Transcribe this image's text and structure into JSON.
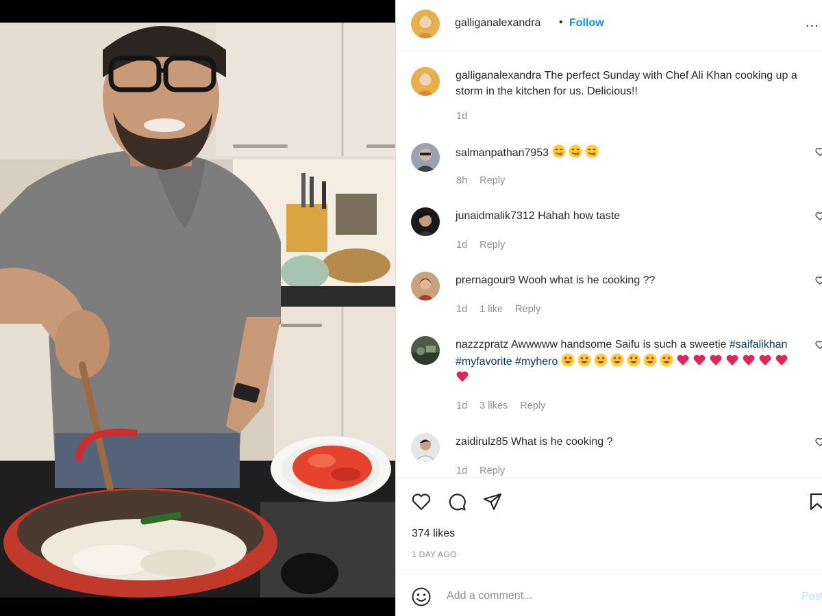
{
  "post": {
    "username": "galliganalexandra",
    "separator": "•",
    "follow_label": "Follow",
    "more_label": "...",
    "caption": "The perfect Sunday with Chef Ali Khan cooking up a storm in the kitchen for us. Delicious!!",
    "caption_time": "1d"
  },
  "comments": [
    {
      "username": "salmanpathan7953",
      "text": "",
      "emojis": [
        "yum-emoji",
        "yum-emoji",
        "yum-emoji"
      ],
      "time": "8h",
      "likes": "",
      "reply_label": "Reply"
    },
    {
      "username": "junaidmalik7312",
      "text": "Hahah how taste",
      "time": "1d",
      "likes": "",
      "reply_label": "Reply"
    },
    {
      "username": "prernagour9",
      "text": "Wooh what is he cooking ??",
      "time": "1d",
      "likes": "1 like",
      "reply_label": "Reply"
    },
    {
      "username": "nazzzpratz",
      "text": "Awwwww handsome Saifu is such a sweetie",
      "hashtags": "#saifalikhan #myfavorite #myhero",
      "time": "1d",
      "likes": "3 likes",
      "reply_label": "Reply"
    },
    {
      "username": "zaidirulz85",
      "text": "What is he cooking ?",
      "time": "1d",
      "likes": "",
      "reply_label": "Reply"
    }
  ],
  "footer": {
    "likes": "374 likes",
    "time_ago": "1 DAY AGO",
    "comment_placeholder": "Add a comment...",
    "post_label": "Post"
  },
  "icons": {
    "like": "heart-icon",
    "comment": "comment-icon",
    "share": "paper-plane-icon",
    "save": "bookmark-icon",
    "emoji": "smiley-icon"
  },
  "colors": {
    "link_blue": "#0095f6",
    "hashtag": "#00376b",
    "muted": "#8e8e8e",
    "post_disabled": "#b2dffc"
  }
}
